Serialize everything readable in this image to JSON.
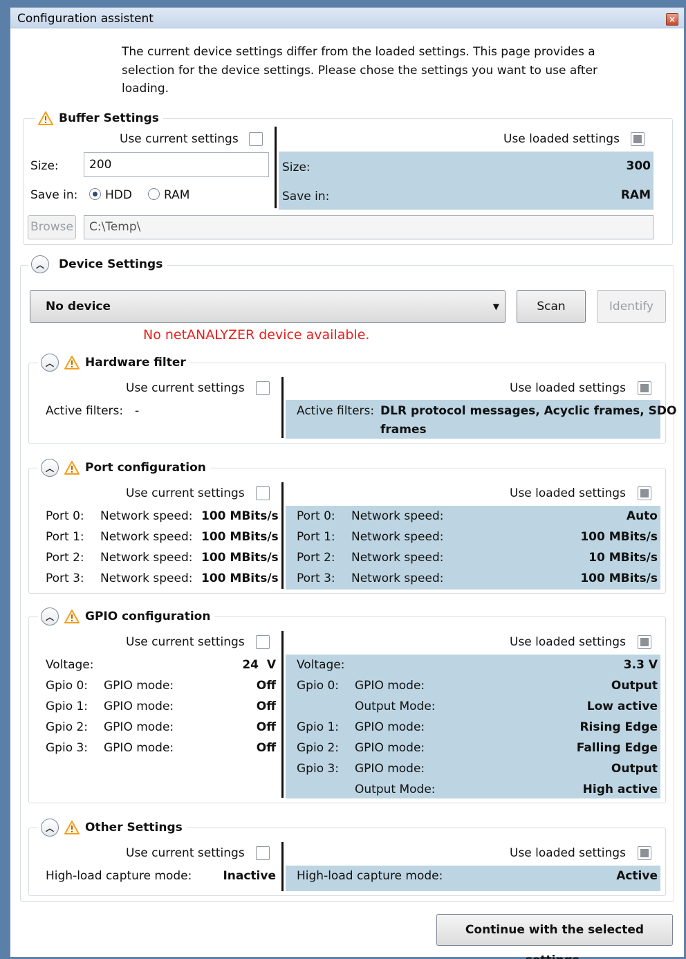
{
  "window": {
    "title": "Configuration assistent",
    "close_glyph": "×"
  },
  "intro": "The current device settings differ from the loaded settings. This page provides a selection for the device settings.  Please chose the settings you want to use after loading.",
  "common": {
    "use_current": "Use current settings",
    "use_loaded": "Use loaded settings"
  },
  "buffer": {
    "title": "Buffer Settings",
    "size_label": "Size:",
    "size_value": "200",
    "save_in_label": "Save in:",
    "radio_hdd": "HDD",
    "radio_ram": "RAM",
    "browse": "Browse",
    "path": "C:\\Temp\\",
    "loaded_size_label": "Size:",
    "loaded_size_value": "300",
    "loaded_save_label": "Save in:",
    "loaded_save_value": "RAM"
  },
  "device": {
    "title": "Device Settings",
    "dropdown_value": "No device",
    "scan": "Scan",
    "identify": "Identify",
    "error": "No netANALYZER device available."
  },
  "hardware_filter": {
    "title": "Hardware filter",
    "current_label": "Active filters:",
    "current_value": "-",
    "loaded_label": "Active filters:",
    "loaded_value_line1": "DLR protocol messages, Acyclic frames, SDO",
    "loaded_value_line2": "frames"
  },
  "ports": {
    "title": "Port configuration",
    "speed_label": "Network speed:",
    "current": [
      {
        "port": "Port 0:",
        "value": "100 MBits/s"
      },
      {
        "port": "Port 1:",
        "value": "100 MBits/s"
      },
      {
        "port": "Port 2:",
        "value": "100 MBits/s"
      },
      {
        "port": "Port 3:",
        "value": "100 MBits/s"
      }
    ],
    "loaded": [
      {
        "port": "Port 0:",
        "value": "Auto"
      },
      {
        "port": "Port 1:",
        "value": "100 MBits/s"
      },
      {
        "port": "Port 2:",
        "value": "10 MBits/s"
      },
      {
        "port": "Port 3:",
        "value": "100 MBits/s"
      }
    ]
  },
  "gpio": {
    "title": "GPIO configuration",
    "voltage_label": "Voltage:",
    "current_voltage": "24  V",
    "loaded_voltage": "3.3 V",
    "mode_label": "GPIO mode:",
    "output_mode_label": "Output Mode:",
    "current": [
      {
        "gpio": "Gpio 0:",
        "value": "Off"
      },
      {
        "gpio": "Gpio 1:",
        "value": "Off"
      },
      {
        "gpio": "Gpio 2:",
        "value": "Off"
      },
      {
        "gpio": "Gpio 3:",
        "value": "Off"
      }
    ],
    "loaded": [
      {
        "gpio": "Gpio 0:",
        "label": "GPIO mode:",
        "value": "Output"
      },
      {
        "gpio": "",
        "label": "Output Mode:",
        "value": "Low active"
      },
      {
        "gpio": "Gpio 1:",
        "label": "GPIO mode:",
        "value": "Rising Edge"
      },
      {
        "gpio": "Gpio 2:",
        "label": "GPIO mode:",
        "value": "Falling Edge"
      },
      {
        "gpio": "Gpio 3:",
        "label": "GPIO mode:",
        "value": "Output"
      },
      {
        "gpio": "",
        "label": "Output Mode:",
        "value": "High active"
      }
    ]
  },
  "other": {
    "title": "Other Settings",
    "label": "High-load capture mode:",
    "current_value": "Inactive",
    "loaded_value": "Active"
  },
  "continue_button": "Continue with the selected settings.",
  "colors": {
    "highlight": "#bdd5e2",
    "error": "#e8201e",
    "warning": "#f0a020"
  },
  "icons": [
    "warning-icon",
    "collapse-chevron-icon",
    "dropdown-arrow-icon",
    "close-icon"
  ]
}
